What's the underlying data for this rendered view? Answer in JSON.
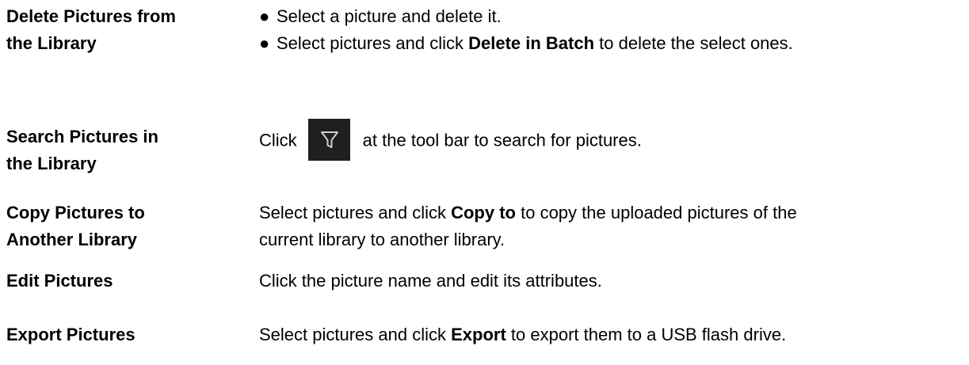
{
  "rows": [
    {
      "label_lines": [
        "Delete Pictures from",
        "the Library"
      ],
      "bullets": [
        {
          "symbol": "●",
          "text": "Select a picture and delete it."
        },
        {
          "symbol": "●",
          "pre": "Select pictures and click ",
          "bold": "Delete in Batch",
          "post": " to delete the select ones."
        }
      ]
    },
    {
      "label_lines": [
        "Search Pictures in",
        "the Library"
      ],
      "pre": "Click",
      "icon": "filter-icon",
      "post": "at the tool bar to search for pictures."
    },
    {
      "label_lines": [
        "Copy Pictures to",
        "Another Library"
      ],
      "pre": "Select pictures and click ",
      "bold": "Copy to",
      "post": " to copy the uploaded pictures of the",
      "line2": "current library to another library."
    },
    {
      "label": "Edit Pictures",
      "text": "Click the picture name and edit its attributes."
    },
    {
      "label": "Export Pictures",
      "pre": "Select pictures and click ",
      "bold": "Export",
      "post": " to export them to a USB flash drive."
    }
  ]
}
